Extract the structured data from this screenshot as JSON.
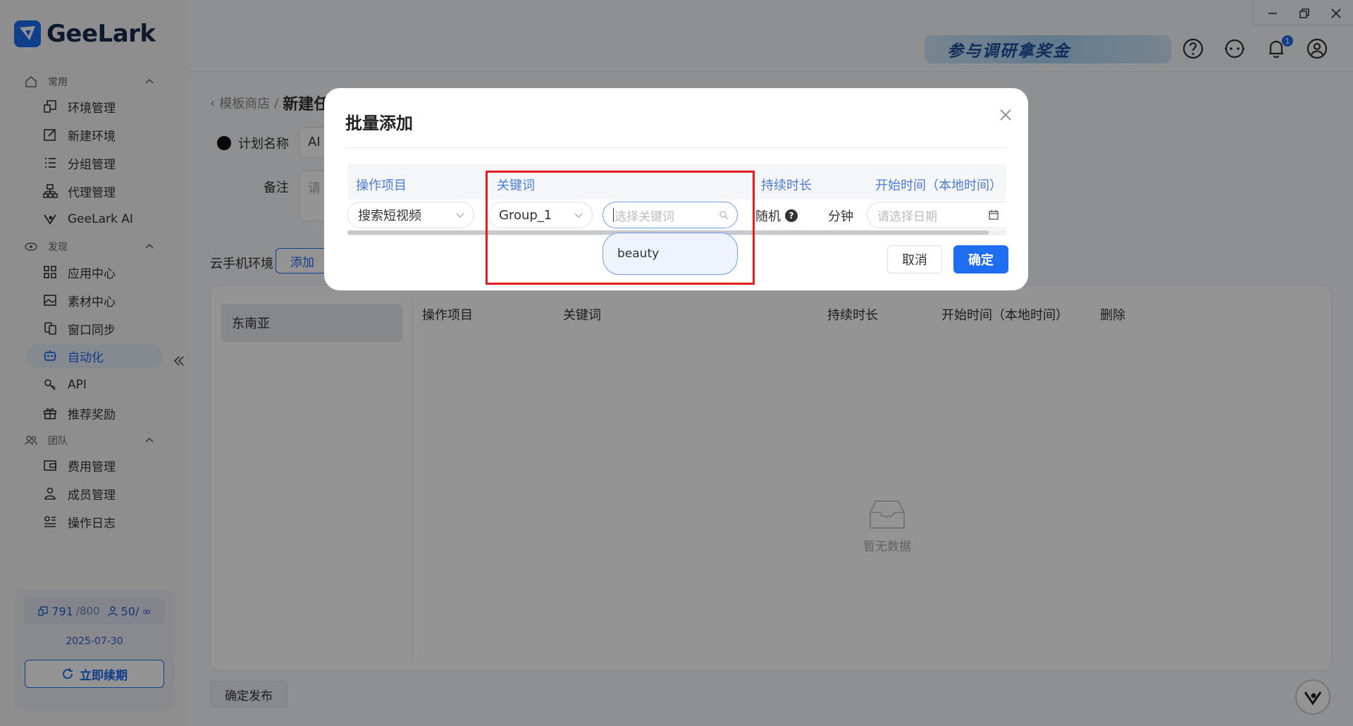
{
  "app": {
    "name": "GeeLark"
  },
  "sidebar": {
    "sections": [
      {
        "label": "常用",
        "icon": "home-icon"
      },
      {
        "label": "发现",
        "icon": "eye-icon"
      },
      {
        "label": "团队",
        "icon": "team-icon"
      }
    ],
    "items": [
      {
        "label": "环境管理",
        "icon": "environment-icon"
      },
      {
        "label": "新建环境",
        "icon": "edit-icon"
      },
      {
        "label": "分组管理",
        "icon": "list-icon"
      },
      {
        "label": "代理管理",
        "icon": "proxy-icon"
      },
      {
        "label": "GeeLark AI",
        "icon": "ai-icon"
      },
      {
        "label": "应用中心",
        "icon": "grid-icon"
      },
      {
        "label": "素材中心",
        "icon": "image-icon"
      },
      {
        "label": "窗口同步",
        "icon": "sync-icon"
      },
      {
        "label": "自动化",
        "icon": "robot-icon",
        "active": true
      },
      {
        "label": "API",
        "icon": "api-icon"
      },
      {
        "label": "推荐奖励",
        "icon": "gift-icon"
      },
      {
        "label": "费用管理",
        "icon": "wallet-icon"
      },
      {
        "label": "成员管理",
        "icon": "user-icon"
      },
      {
        "label": "操作日志",
        "icon": "log-icon"
      }
    ],
    "quota": {
      "env_used": "791",
      "env_total": "/800",
      "member_used": "50/",
      "member_total": "∞",
      "expiry": "2025-07-30",
      "renew_label": "立即续期"
    }
  },
  "topbar": {
    "promo_text": "参与调研拿奖金",
    "notification_count": "1"
  },
  "page": {
    "breadcrumb_parent": "模板商店",
    "breadcrumb_sep": "/",
    "breadcrumb_current": "新建任",
    "plan_name_label": "计划名称",
    "plan_name_value": "AI",
    "note_label": "备注",
    "note_placeholder": "请",
    "cloud_env_label": "云手机环境",
    "add_label": "添加",
    "region_tab": "东南亚",
    "table_headers": [
      "操作项目",
      "关键词",
      "持续时长",
      "开始时间（本地时间）",
      "删除"
    ],
    "empty_text": "暂无数据",
    "publish_label": "确定发布"
  },
  "modal": {
    "title": "批量添加",
    "headers": [
      "操作项目",
      "关键词",
      "持续时长",
      "开始时间（本地时间）"
    ],
    "action_value": "搜索短视频",
    "group_value": "Group_1",
    "keyword_placeholder": "选择关键词",
    "dropdown_option": "beauty",
    "duration_value": "随机",
    "duration_help": "?",
    "duration_unit": "分钟",
    "date_placeholder": "请选择日期",
    "cancel_label": "取消",
    "ok_label": "确定"
  },
  "colors": {
    "accent": "#1e6cf0",
    "highlight": "#e02020"
  }
}
